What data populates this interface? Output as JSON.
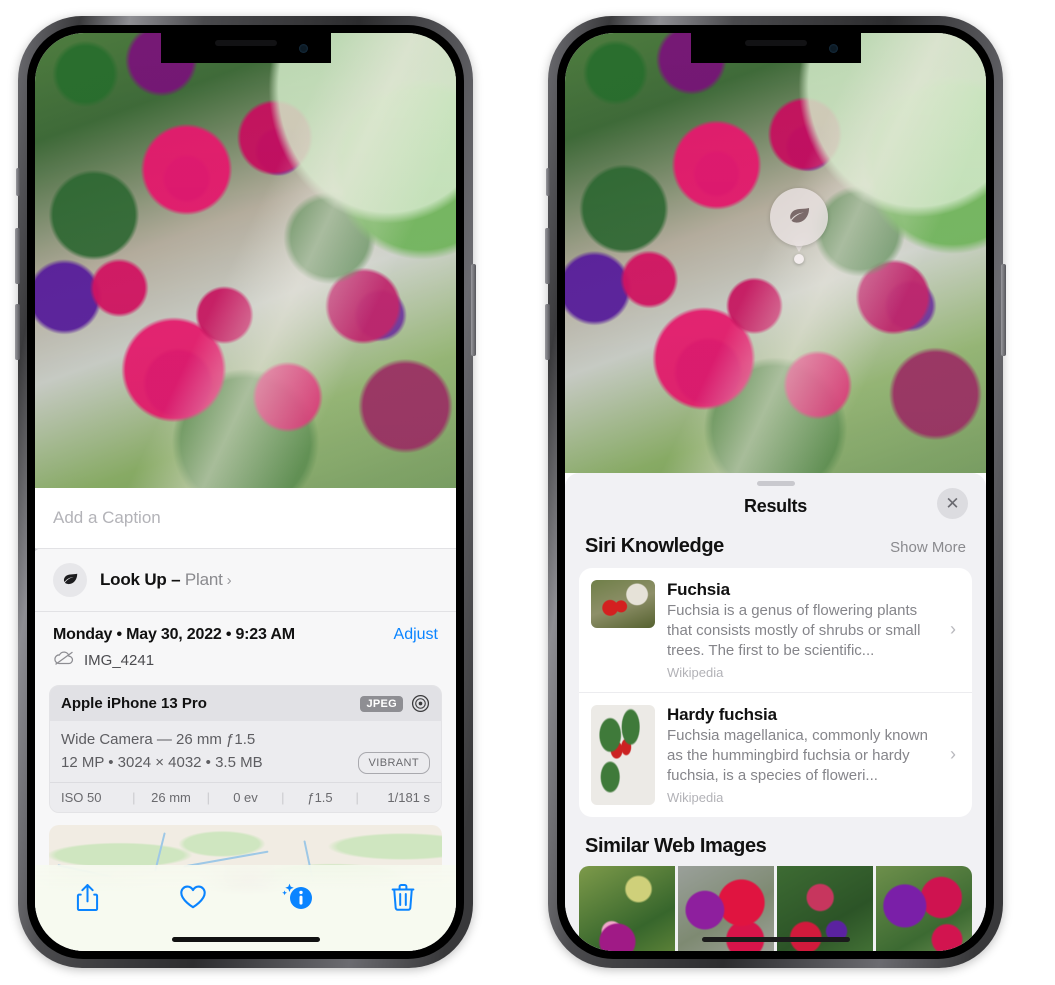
{
  "left_phone": {
    "name": "iPhone photo detail view",
    "caption_placeholder": "Add a Caption",
    "lookup": {
      "icon": "leaf-icon",
      "label": "Look Up –",
      "subject": "Plant",
      "chevron": "›"
    },
    "date_line": "Monday • May 30, 2022 • 9:23 AM",
    "adjust_label": "Adjust",
    "cloud_icon": "icloud-slash-icon",
    "filename": "IMG_4241",
    "metadata": {
      "device": "Apple iPhone 13 Pro",
      "format_badge": "JPEG",
      "aperture_icon": "aperture-icon",
      "lens_line": "Wide Camera — 26 mm ƒ1.5",
      "specs_line": "12 MP • 3024 × 4032 • 3.5 MB",
      "style_badge": "VIBRANT",
      "exif": [
        "ISO 50",
        "26 mm",
        "0 ev",
        "ƒ1.5",
        "1/181 s"
      ]
    },
    "toolbar": [
      {
        "icon": "share-icon",
        "label": "Share"
      },
      {
        "icon": "heart-icon",
        "label": "Favorite"
      },
      {
        "icon": "info-sparkle-icon",
        "label": "Info"
      },
      {
        "icon": "trash-icon",
        "label": "Delete"
      }
    ]
  },
  "right_phone": {
    "name": "Visual Look Up results",
    "pin": {
      "icon": "leaf-icon"
    },
    "sheet_title": "Results",
    "close_icon": "close-icon",
    "sections": [
      {
        "title": "Siri Knowledge",
        "action": "Show More",
        "cards": [
          {
            "title": "Fuchsia",
            "description": "Fuchsia is a genus of flowering plants that consists mostly of shrubs or small trees. The first to be scientific...",
            "source": "Wikipedia",
            "chevron": "›",
            "thumb": "fuchsia-red-flowers-thumbnail"
          },
          {
            "title": "Hardy fuchsia",
            "description": "Fuchsia magellanica, commonly known as the hummingbird fuchsia or hardy fuchsia, is a species of floweri...",
            "source": "Wikipedia",
            "chevron": "›",
            "thumb": "hardy-fuchsia-branch-thumbnail"
          }
        ]
      },
      {
        "title": "Similar Web Images",
        "images": [
          "fuchsia-pink-purple-bloom",
          "fuchsia-red-closeup",
          "fuchsia-bush-buds",
          "fuchsia-purple-magenta-cluster"
        ]
      }
    ]
  },
  "colors": {
    "accent_blue": "#0a84ff",
    "sheet_bg": "#f1f1f4",
    "card_bg": "#ffffff",
    "secondary_text": "#85858a"
  }
}
